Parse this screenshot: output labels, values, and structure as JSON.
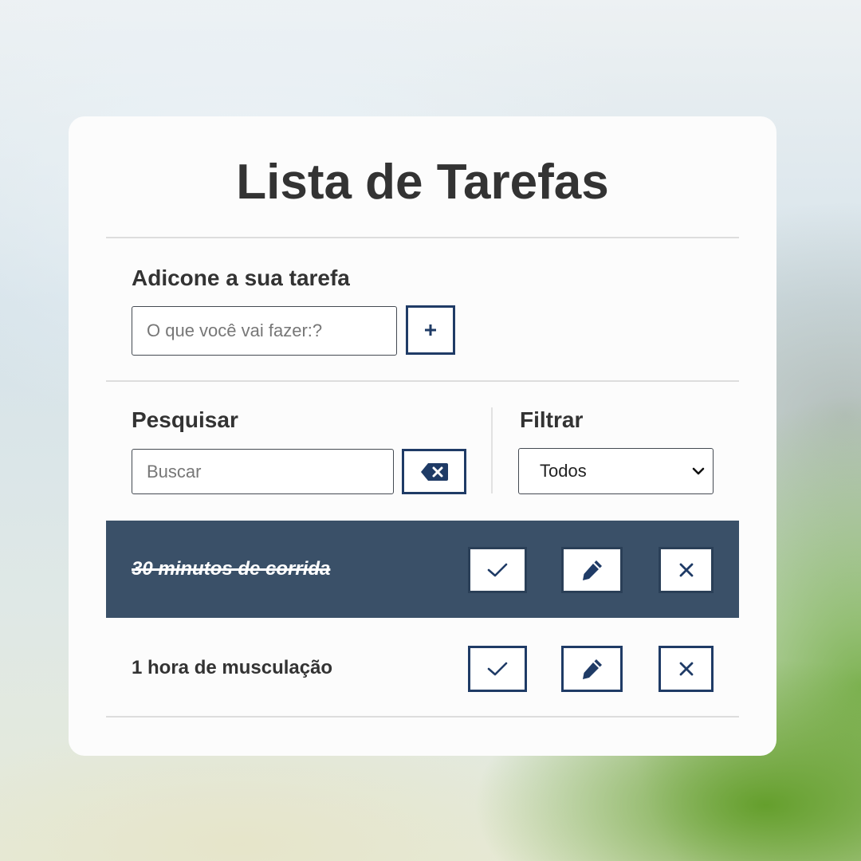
{
  "app": {
    "title": "Lista de Tarefas"
  },
  "add_section": {
    "label": "Adicone a sua tarefa",
    "input_placeholder": "O que você vai fazer:?",
    "input_value": "",
    "add_button_icon": "plus-icon"
  },
  "search_section": {
    "label": "Pesquisar",
    "input_placeholder": "Buscar",
    "input_value": "",
    "clear_button_icon": "backspace-icon"
  },
  "filter_section": {
    "label": "Filtrar",
    "selected": "Todos"
  },
  "tasks": [
    {
      "text": "30 minutos de corrida",
      "done": true
    },
    {
      "text": "1 hora de musculação",
      "done": false
    }
  ],
  "task_action_icons": [
    "check-icon",
    "pencil-icon",
    "close-icon"
  ],
  "colors": {
    "accent": "#1f3b66",
    "done_row_bg": "#3a5068",
    "card_bg": "#fcfcfc",
    "text": "#333333"
  }
}
